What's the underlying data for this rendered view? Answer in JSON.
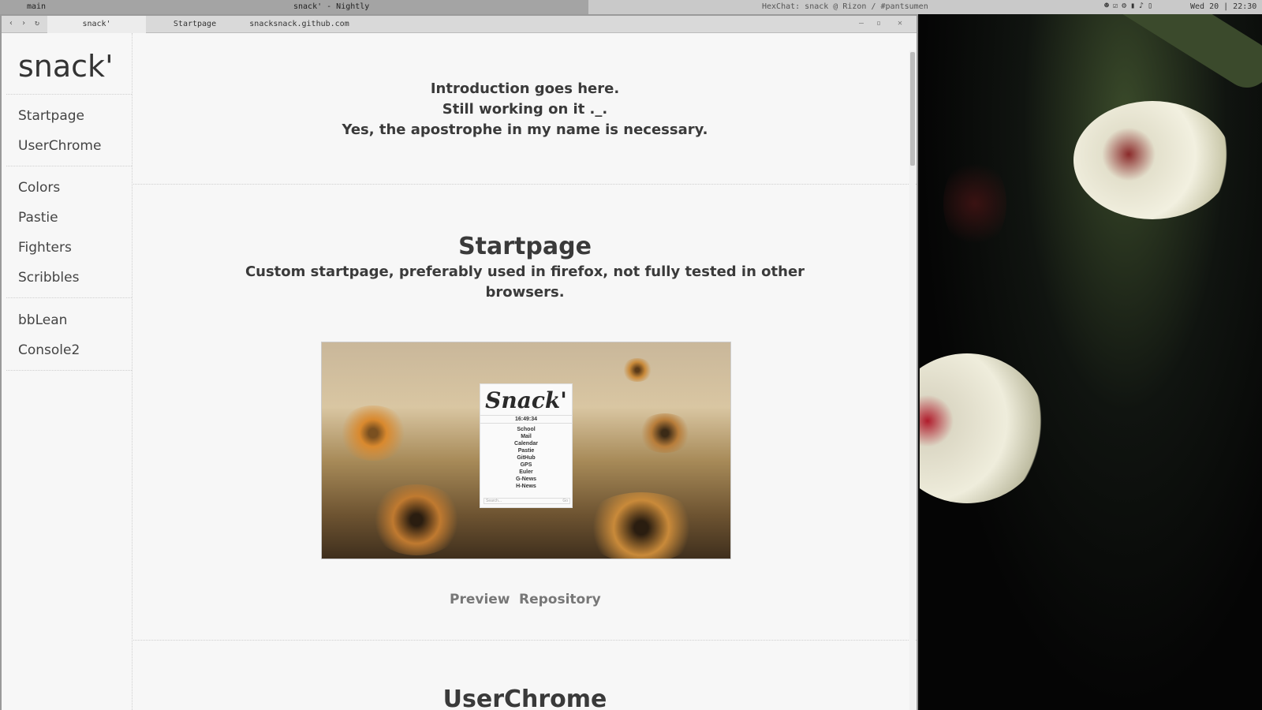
{
  "panel": {
    "workspace": "main",
    "window_title": "snack' - Nightly",
    "hexchat": "HexChat: snack @ Rizon / #pantsumen",
    "clock": "Wed 20 | 22:30"
  },
  "browser": {
    "nav": {
      "back": "‹",
      "forward": "›",
      "reload": "↻"
    },
    "tabs": [
      "snack'",
      "Startpage",
      "snacksnack.github.com"
    ],
    "window_buttons": {
      "minimize": "–",
      "maximize": "▫",
      "close": "✕"
    }
  },
  "sidebar": {
    "logo": "snack'",
    "group1": [
      "Startpage",
      "UserChrome"
    ],
    "group2": [
      "Colors",
      "Pastie",
      "Fighters",
      "Scribbles"
    ],
    "group3": [
      "bbLean",
      "Console2"
    ]
  },
  "intro": {
    "lines": [
      "Introduction goes here.",
      "Still working on it ._.",
      "Yes, the apostrophe in my name is necessary."
    ]
  },
  "startpage": {
    "title": "Startpage",
    "desc_lines": [
      "Custom startpage, preferably used in firefox, not fully tested in other",
      "browsers."
    ],
    "screenshot": {
      "logo": "Snack'",
      "time": "16:49:34",
      "links": [
        "School",
        "Mail",
        "Calendar",
        "Pastie",
        "GitHub",
        "GPS",
        "Euler",
        "G-News",
        "H-News"
      ],
      "search_placeholder": "Search...",
      "go": "Go"
    },
    "preview_label": "Preview",
    "repository_label": "Repository"
  },
  "userchrome": {
    "title": "UserChrome"
  }
}
